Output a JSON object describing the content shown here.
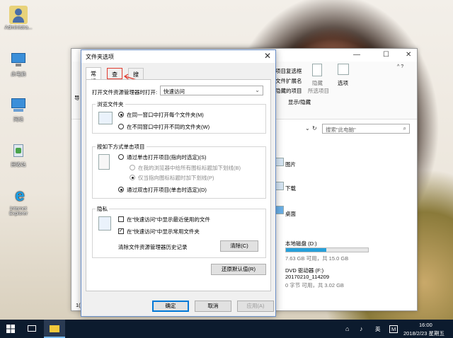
{
  "desktop": {
    "icons": [
      {
        "label": "Administra..."
      },
      {
        "label": "此电脑"
      },
      {
        "label": "网络"
      },
      {
        "label": "回收站"
      },
      {
        "label": "Internet Explorer"
      }
    ]
  },
  "explorer": {
    "ribbon": {
      "show_hide_group": "显示/隐藏",
      "item_checkbox": "项目复选框",
      "file_ext": "文件扩展名",
      "hidden_items": "隐藏的项目",
      "hide_selected": "隐藏",
      "hide_selected2": "所选项目",
      "options": "选项",
      "nav_label": "导"
    },
    "search_placeholder": "搜索\"此电脑\"",
    "folders": [
      {
        "name": "图片"
      },
      {
        "name": "下载"
      },
      {
        "name": "桌面"
      }
    ],
    "drives": [
      {
        "name": "本地磁盘 (D:)",
        "usage": "7.63 GB 可用，共 15.0 GB",
        "fill": 0.49
      },
      {
        "name": "DVD 驱动器 (F:)",
        "label": "20170210_114209",
        "usage": "0 字节 可用，共 3.02 GB"
      }
    ],
    "count_prefix": "1("
  },
  "dialog": {
    "title": "文件夹选项",
    "tabs": [
      {
        "label": "常规"
      },
      {
        "label": "查看"
      },
      {
        "label": "搜索"
      }
    ],
    "open_label": "打开文件资源管理器时打开:",
    "open_value": "快速访问",
    "browse_group": "浏览文件夹",
    "browse_same": "在同一窗口中打开每个文件夹(M)",
    "browse_new": "在不同窗口中打开不同的文件夹(W)",
    "click_group": "按如下方式单击项目",
    "single_click": "通过单击打开项目(指向时选定)(S)",
    "underline_browser": "在我的浏览器中给所有图标标题加下划线(B)",
    "underline_point": "仅当指向图标标题时加下划线(P)",
    "double_click": "通过双击打开项目(单击时选定)(D)",
    "privacy_group": "隐私",
    "recent_files": "在\"快速访问\"中显示最近使用的文件",
    "frequent_folders": "在\"快速访问\"中显示常用文件夹",
    "clear_history": "清除文件资源管理器历史记录",
    "clear_btn": "清除(C)",
    "restore_btn": "还原默认值(R)",
    "ok_btn": "确定",
    "cancel_btn": "取消",
    "apply_btn": "应用(A)"
  },
  "taskbar": {
    "time": "16:00",
    "date": "2018/2/23 星期五",
    "ime": "英",
    "ime2": "M"
  }
}
